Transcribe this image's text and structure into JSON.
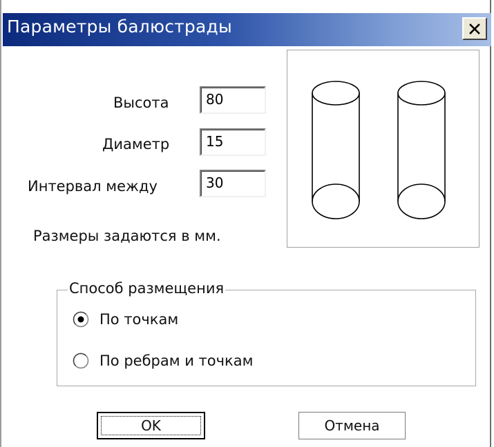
{
  "dialog": {
    "title": "Параметры балюстрады",
    "close_symbol": "×"
  },
  "fields": {
    "height": {
      "label": "Высота",
      "value": "80"
    },
    "diameter": {
      "label": "Диаметр",
      "value": "15"
    },
    "interval": {
      "label": "Интервал между",
      "value": "30"
    }
  },
  "note": "Размеры задаются в мм.",
  "placement": {
    "legend": "Способ размещения",
    "options": [
      {
        "label": "По точкам",
        "selected": true
      },
      {
        "label": "По ребрам и точкам",
        "selected": false
      }
    ]
  },
  "buttons": {
    "ok": "OK",
    "cancel": "Отмена"
  },
  "preview": {
    "icon": "balusters-preview"
  }
}
